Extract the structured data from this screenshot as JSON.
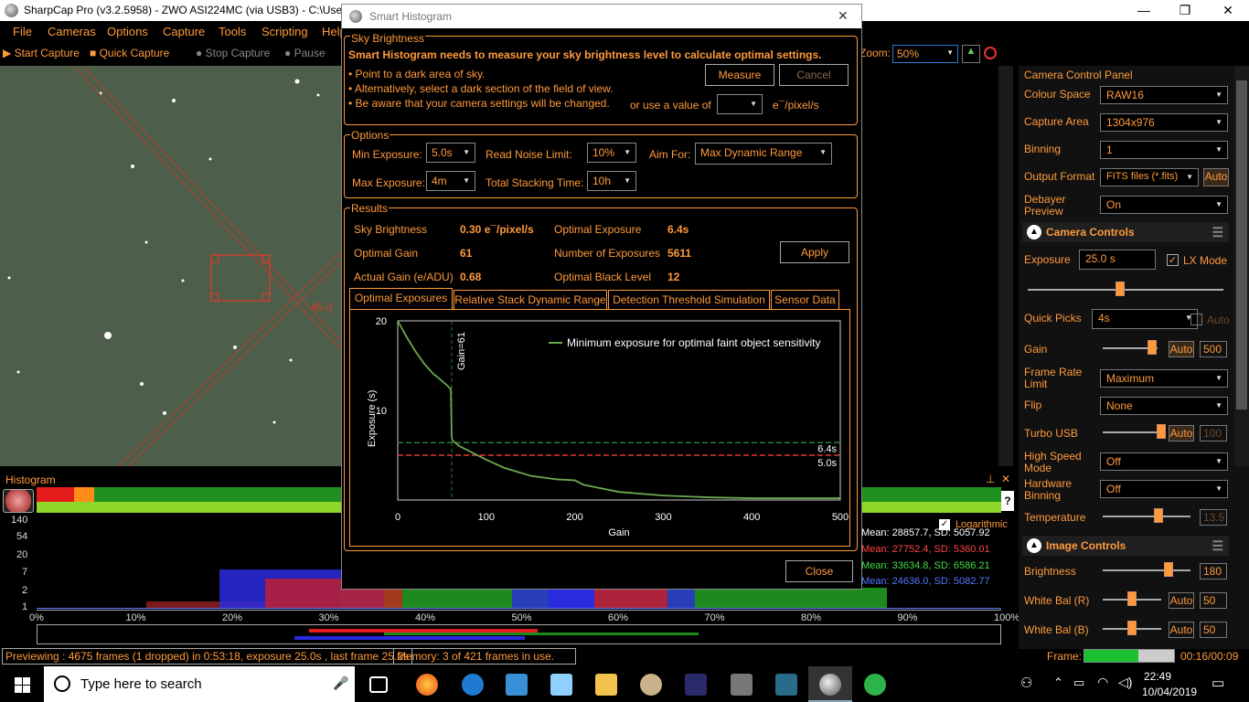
{
  "app": {
    "title": "SharpCap Pro (v3.2.5958) - ZWO ASI224MC (via USB3) - C:\\Users\\Ki"
  },
  "menu": [
    "File",
    "Cameras",
    "Options",
    "Capture",
    "Tools",
    "Scripting",
    "Help"
  ],
  "toolbar": {
    "start_capture": "Start Capture",
    "quick_capture": "Quick Capture",
    "stop_capture": "Stop Capture",
    "pause": "Pause",
    "zoom_label": "Zoom:",
    "zoom_value": "50%"
  },
  "preview": {
    "angle_label": "45.0"
  },
  "dialog": {
    "title": "Smart Histogram",
    "sky": {
      "group": "Sky Brightness",
      "headline": "Smart Histogram needs to measure your sky brightness level to calculate optimal settings.",
      "bullets": [
        "• Point to a dark area of sky.",
        "• Alternatively, select a dark section of the field of view.",
        "• Be aware that your camera settings will be changed."
      ],
      "measure": "Measure",
      "cancel": "Cancel",
      "or_use": "or use a value of",
      "unit": "e¯/pixel/s"
    },
    "options": {
      "group": "Options",
      "min_exposure_label": "Min Exposure:",
      "min_exposure": "5.0s",
      "read_noise_label": "Read Noise Limit:",
      "read_noise": "10%",
      "aim_for_label": "Aim For:",
      "aim_for": "Max Dynamic Range",
      "max_exposure_label": "Max Exposure:",
      "max_exposure": "4m",
      "total_stacking_label": "Total Stacking Time:",
      "total_stacking": "10h"
    },
    "results": {
      "group": "Results",
      "sky_brightness_label": "Sky Brightness",
      "sky_brightness": "0.30 e¯/pixel/s",
      "optimal_exposure_label": "Optimal Exposure",
      "optimal_exposure": "6.4s",
      "optimal_gain_label": "Optimal Gain",
      "optimal_gain": "61",
      "num_exposures_label": "Number of Exposures",
      "num_exposures": "5611",
      "actual_gain_label": "Actual Gain (e/ADU)",
      "actual_gain": "0.68",
      "optimal_black_label": "Optimal Black Level",
      "optimal_black": "12",
      "apply": "Apply"
    },
    "tabs": [
      "Optimal Exposures",
      "Relative Stack Dynamic Range",
      "Detection Threshold Simulation",
      "Sensor Data"
    ],
    "close": "Close"
  },
  "chart_data": {
    "type": "line",
    "xlabel": "Gain",
    "ylabel": "Exposure (s)",
    "xlim": [
      0,
      500
    ],
    "ylim": [
      0,
      20
    ],
    "x_ticks": [
      "0",
      "100",
      "200",
      "300",
      "400",
      "500"
    ],
    "y_ticks": [
      "10",
      "20"
    ],
    "series": [
      {
        "name": "Minimum exposure for optimal faint object sensitivity",
        "color": "#6aa84f",
        "x": [
          0,
          10,
          20,
          30,
          40,
          50,
          60,
          61,
          62,
          70,
          80,
          100,
          120,
          150,
          180,
          200,
          210,
          250,
          300,
          350,
          400,
          450,
          500
        ],
        "y": [
          20,
          18.2,
          16.6,
          15.2,
          14.1,
          13.3,
          12.4,
          7.0,
          6.6,
          6.0,
          5.5,
          4.5,
          3.6,
          2.7,
          2.3,
          2.2,
          1.7,
          0.9,
          0.5,
          0.3,
          0.2,
          0.2,
          0.2
        ]
      }
    ],
    "annotations": [
      {
        "text": "Gain=61",
        "x": 61
      },
      {
        "text": "6.4s",
        "y": 6.4,
        "color": "#2e7d32"
      },
      {
        "text": "5.0s",
        "y": 5.0,
        "color": "#e53935"
      }
    ]
  },
  "histogram": {
    "label": "Histogram",
    "logarithmic": "Logarithmic",
    "y_ticks": [
      "140",
      "54",
      "20",
      "7",
      "2",
      "1"
    ],
    "x_ticks": [
      "0%",
      "10%",
      "20%",
      "30%",
      "40%",
      "50%",
      "60%",
      "70%",
      "80%",
      "90%",
      "100%"
    ],
    "means": [
      {
        "text": "Mean: 28857.7, SD: 5057.92",
        "color": "#ffffff"
      },
      {
        "text": "Mean: 27752.4, SD: 5360.01",
        "color": "#ff4444"
      },
      {
        "text": "Mean: 33634.8, SD: 6586.21",
        "color": "#44dd44"
      },
      {
        "text": "Mean: 24636.0, SD: 5082.77",
        "color": "#5577ff"
      }
    ]
  },
  "status": {
    "previewing": "Previewing : 4675 frames (1 dropped) in 0:53:18, exposure 25.0s , last frame 25.2s",
    "memory": "Memory: 3 of 421 frames in use.",
    "frame_label": "Frame:",
    "frame_time": "00:16/00:09",
    "frame_progress": 0.6
  },
  "panel": {
    "title": "Camera Control Panel",
    "colour_space_label": "Colour Space",
    "colour_space": "RAW16",
    "capture_area_label": "Capture Area",
    "capture_area": "1304x976",
    "binning_label": "Binning",
    "binning": "1",
    "output_format_label": "Output Format",
    "output_format": "FITS files (*.fits)",
    "auto": "Auto",
    "debayer_label": "Debayer Preview",
    "debayer": "On",
    "camera_controls": "Camera Controls",
    "exposure_label": "Exposure",
    "exposure": "25.0 s",
    "lx_mode": "LX Mode",
    "quick_picks_label": "Quick Picks",
    "quick_picks": "4s",
    "gain_label": "Gain",
    "gain": "500",
    "frame_rate_label": "Frame Rate Limit",
    "frame_rate": "Maximum",
    "flip_label": "Flip",
    "flip": "None",
    "turbo_label": "Turbo USB",
    "turbo": "100",
    "high_speed_label": "High Speed Mode",
    "high_speed": "Off",
    "hw_binning_label": "Hardware Binning",
    "hw_binning": "Off",
    "temperature_label": "Temperature",
    "temperature": "13.5",
    "image_controls": "Image Controls",
    "brightness_label": "Brightness",
    "brightness": "180",
    "wb_r_label": "White Bal (R)",
    "wb_r": "50",
    "wb_b_label": "White Bal (B)",
    "wb_b": "50"
  },
  "taskbar": {
    "search_placeholder": "Type here to search",
    "time": "22:49",
    "date": "10/04/2019"
  }
}
